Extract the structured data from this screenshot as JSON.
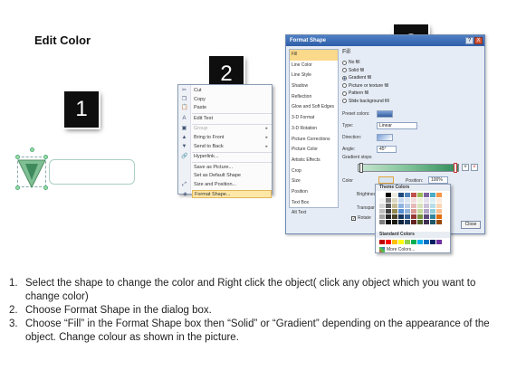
{
  "page_title": "Edit Color",
  "badges": [
    "1",
    "2",
    "3"
  ],
  "context_menu": {
    "items": [
      {
        "label": "Cut",
        "icon": "scissors-icon",
        "glyph": "✂",
        "dim": false,
        "arrow": false
      },
      {
        "label": "Copy",
        "icon": "copy-icon",
        "glyph": "❐",
        "dim": false,
        "arrow": false
      },
      {
        "label": "Paste",
        "icon": "paste-icon",
        "glyph": "📋",
        "dim": false,
        "arrow": false
      },
      {
        "label": "Edit Text",
        "icon": "edit-text-icon",
        "glyph": "A",
        "dim": false,
        "arrow": false
      },
      {
        "label": "Group",
        "icon": "group-icon",
        "glyph": "▣",
        "dim": true,
        "arrow": true
      },
      {
        "label": "Bring to Front",
        "icon": "bring-front-icon",
        "glyph": "▲",
        "dim": false,
        "arrow": true
      },
      {
        "label": "Send to Back",
        "icon": "send-back-icon",
        "glyph": "▼",
        "dim": false,
        "arrow": true
      },
      {
        "label": "Hyperlink...",
        "icon": "hyperlink-icon",
        "glyph": "🔗",
        "dim": false,
        "arrow": false
      },
      {
        "label": "Save as Picture...",
        "icon": "",
        "glyph": "",
        "dim": false,
        "arrow": false
      },
      {
        "label": "Set as Default Shape",
        "icon": "",
        "glyph": "",
        "dim": false,
        "arrow": false
      },
      {
        "label": "Size and Position...",
        "icon": "size-position-icon",
        "glyph": "⤢",
        "dim": false,
        "arrow": false
      },
      {
        "label": "Format Shape...",
        "icon": "format-shape-icon",
        "glyph": "◈",
        "dim": false,
        "arrow": false,
        "active": true
      }
    ]
  },
  "dialog": {
    "title": "Format Shape",
    "help_button": "?",
    "close_button": "X",
    "categories": [
      "Fill",
      "Line Color",
      "Line Style",
      "Shadow",
      "Reflection",
      "Glow and Soft Edges",
      "3-D Format",
      "3-D Rotation",
      "Picture Corrections",
      "Picture Color",
      "Artistic Effects",
      "Crop",
      "Size",
      "Position",
      "Text Box",
      "Alt Text"
    ],
    "active_category": "Fill",
    "section_title": "Fill",
    "fill_options": [
      {
        "label": "No fill",
        "checked": false
      },
      {
        "label": "Solid fill",
        "checked": false
      },
      {
        "label": "Gradient fill",
        "checked": true
      },
      {
        "label": "Picture or texture fill",
        "checked": false
      },
      {
        "label": "Pattern fill",
        "checked": false
      },
      {
        "label": "Slide background fill",
        "checked": false
      }
    ],
    "preset_colors_label": "Preset colors:",
    "type_label": "Type:",
    "type_value": "Linear",
    "direction_label": "Direction:",
    "angle_label": "Angle:",
    "angle_value": "45°",
    "gradient_stops_label": "Gradient stops",
    "color_label": "Color",
    "position_label": "Position:",
    "position_value": "100%",
    "brightness_label": "Brightness",
    "transparency_label": "Transparen",
    "rotate_label": "Rotate",
    "close_label": "Close"
  },
  "color_picker": {
    "theme_header": "Theme Colors",
    "standard_header": "Standard Colors",
    "more_label": "More Colors...",
    "theme_colors": [
      "#ffffff",
      "#000000",
      "#eeece1",
      "#1f497d",
      "#4f81bd",
      "#c0504d",
      "#9bbb59",
      "#8064a2",
      "#4bacc6",
      "#f79646",
      "#f2f2f2",
      "#7f7f7f",
      "#ddd9c3",
      "#c6d9f0",
      "#dbe5f1",
      "#f2dcdb",
      "#ebf1dd",
      "#e5e0ec",
      "#dbeef3",
      "#fdeada",
      "#d8d8d8",
      "#595959",
      "#c4bd97",
      "#8db3e2",
      "#b8cce4",
      "#e5b9b7",
      "#d7e3bc",
      "#ccc1d9",
      "#b7dde8",
      "#fbd5b5",
      "#bfbfbf",
      "#3f3f3f",
      "#938953",
      "#548dd4",
      "#95b3d7",
      "#d99694",
      "#c3d69b",
      "#b2a2c7",
      "#92cddc",
      "#fac08f",
      "#a5a5a5",
      "#262626",
      "#494429",
      "#17365d",
      "#366092",
      "#953734",
      "#76923c",
      "#5f497a",
      "#31859b",
      "#e36c09",
      "#7f7f7f",
      "#0c0c0c",
      "#1d1b10",
      "#0f243e",
      "#244061",
      "#632423",
      "#4f6128",
      "#3f3151",
      "#205867",
      "#974806"
    ],
    "standard_colors": [
      "#c00000",
      "#ff0000",
      "#ffc000",
      "#ffff00",
      "#92d050",
      "#00b050",
      "#00b0f0",
      "#0070c0",
      "#002060",
      "#7030a0"
    ]
  },
  "instructions": [
    {
      "num": "1.",
      "text": "Select the shape to change the color and Right click the object( click any object which you want to change color)"
    },
    {
      "num": "2.",
      "text": "Choose Format Shape in the dialog box."
    },
    {
      "num": "3.",
      "text": "Choose “Fill” in the Format Shape box then “Solid” or “Gradient” depending on the appearance of the object. Change colour as shown in the picture."
    }
  ]
}
